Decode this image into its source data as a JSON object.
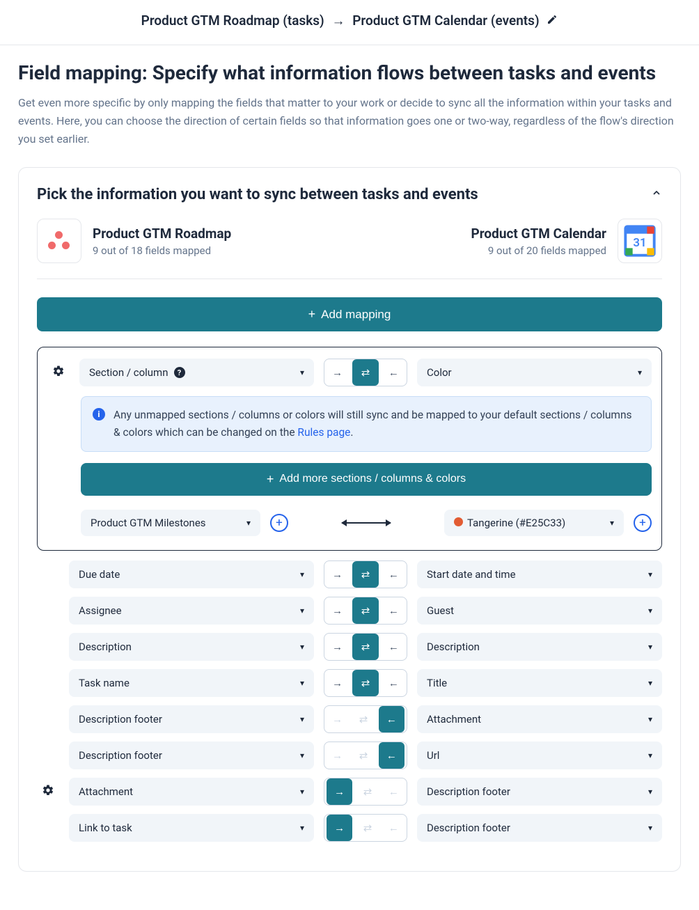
{
  "header": {
    "source": "Product GTM Roadmap (tasks)",
    "target": "Product GTM Calendar (events)"
  },
  "page": {
    "title": "Field mapping: Specify what information flows between tasks and events",
    "description": "Get even more specific by only mapping the fields that matter to your work or decide to sync all the information within your tasks and events. Here, you can choose the direction of certain fields so that information goes one or two-way, regardless of the flow's direction you set earlier."
  },
  "panel": {
    "title": "Pick the information you want to sync between tasks and events",
    "left_tool": {
      "name": "Product GTM Roadmap",
      "status": "9 out of 18 fields mapped"
    },
    "right_tool": {
      "name": "Product GTM Calendar",
      "status": "9 out of 20 fields mapped"
    },
    "add_mapping_label": "Add mapping"
  },
  "section_mapping": {
    "left_field": "Section / column",
    "right_field": "Color",
    "info_text_a": "Any unmapped sections / columns or colors will still sync and be mapped to your default sections / columns & colors which can be changed on the ",
    "info_link": "Rules page",
    "info_text_b": ".",
    "add_more_label": "Add more sections / columns & colors",
    "sub_left": "Product GTM Milestones",
    "sub_right": "Tangerine (#E25C33)"
  },
  "mappings": [
    {
      "left": "Due date",
      "right": "Start date and time",
      "direction": "both",
      "gear": false
    },
    {
      "left": "Assignee",
      "right": "Guest",
      "direction": "both",
      "gear": false
    },
    {
      "left": "Description",
      "right": "Description",
      "direction": "both",
      "gear": false
    },
    {
      "left": "Task name",
      "right": "Title",
      "direction": "both",
      "gear": false
    },
    {
      "left": "Description footer",
      "right": "Attachment",
      "direction": "left",
      "gear": false
    },
    {
      "left": "Description footer",
      "right": "Url",
      "direction": "left",
      "gear": false
    },
    {
      "left": "Attachment",
      "right": "Description footer",
      "direction": "right",
      "gear": true
    },
    {
      "left": "Link to task",
      "right": "Description footer",
      "direction": "right",
      "gear": false
    }
  ]
}
